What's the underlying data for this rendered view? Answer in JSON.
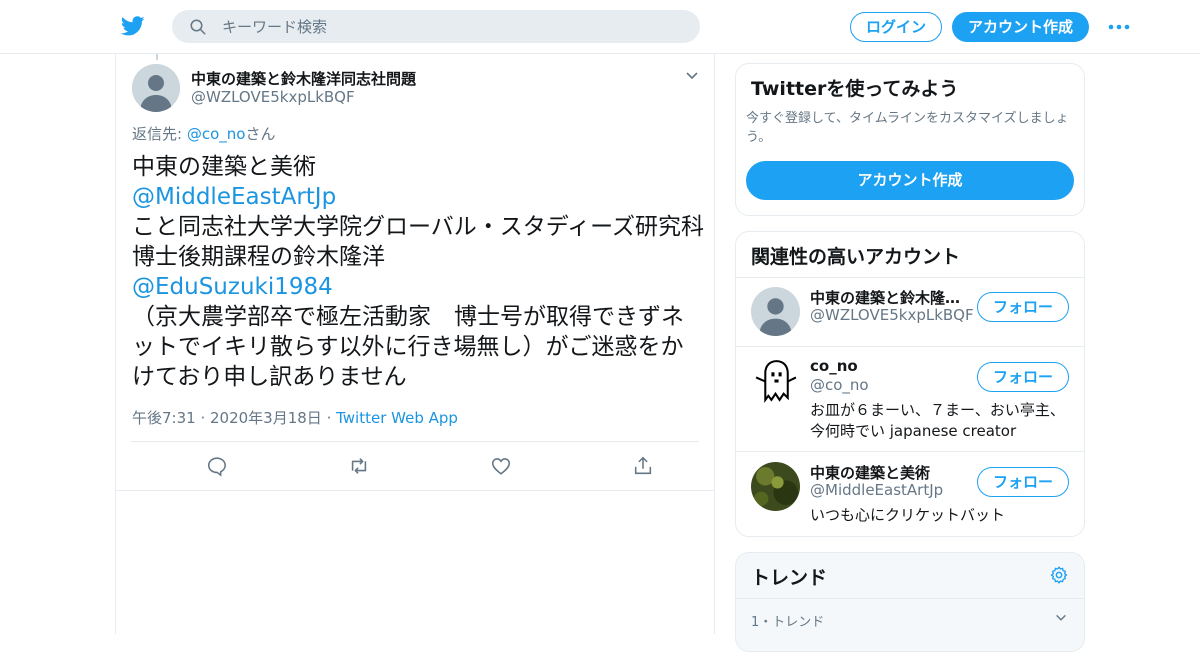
{
  "header": {
    "search_placeholder": "キーワード検索",
    "login_label": "ログイン",
    "signup_label": "アカウント作成"
  },
  "tweet": {
    "display_name": "中東の建築と鈴木隆洋同志社問題",
    "handle": "@WZLOVE5kxpLkBQF",
    "reply_prefix": "返信先: ",
    "reply_to": "@co_no",
    "reply_suffix": "さん",
    "text_1": "中東の建築と美術",
    "mention_1": "@MiddleEastArtJp",
    "text_2": " こと同志社大学大学院グローバル・スタディーズ研究科博士後期課程の鈴木隆洋",
    "mention_2": "@EduSuzuki1984",
    "text_3": "（京大農学部卒で極左活動家　博士号が取得できずネットでイキリ散らす以外に行き場無し）がご迷惑をかけており申し訳ありません",
    "timestamp": "午後7:31 · 2020年3月18日",
    "separator": " · ",
    "source": "Twitter Web App"
  },
  "signup_card": {
    "title": "Twitterを使ってみよう",
    "description": "今すぐ登録して、タイムラインをカスタマイズしましょう。",
    "button_label": "アカウント作成"
  },
  "related": {
    "title": "関連性の高いアカウント",
    "follow_label": "フォロー",
    "accounts": [
      {
        "name": "中東の建築と鈴木隆洋同志社問題",
        "handle": "@WZLOVE5kxpLkBQF",
        "bio": ""
      },
      {
        "name": "co_no",
        "handle": "@co_no",
        "bio": "お皿が６まーい、７まー、おい亭主、今何時でい japanese creator"
      },
      {
        "name": "中東の建築と美術",
        "handle": "@MiddleEastArtJp",
        "bio": "いつも心にクリケットバット"
      }
    ]
  },
  "trends": {
    "title": "トレンド",
    "first_meta": "1・トレンド"
  },
  "colors": {
    "accent": "#1da1f2",
    "link": "#1b95e0",
    "muted": "#657786",
    "border": "#e6ecf0"
  }
}
